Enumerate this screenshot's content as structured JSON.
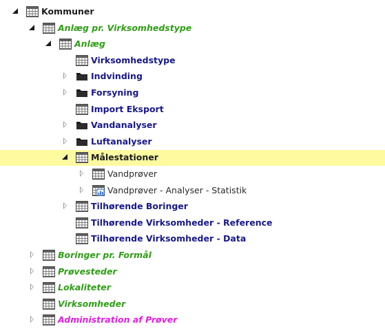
{
  "tree": {
    "nodes": [
      {
        "label": "Kommuner",
        "level": 0,
        "toggle": "expanded",
        "icon": "table-icon",
        "style": "bold-dark"
      },
      {
        "label": "Anlæg pr. Virksomhedstype",
        "level": 1,
        "toggle": "expanded",
        "icon": "table-icon",
        "style": "green"
      },
      {
        "label": "Anlæg",
        "level": 2,
        "toggle": "expanded",
        "icon": "table-icon",
        "style": "green"
      },
      {
        "label": "Virksomhedstype",
        "level": 3,
        "toggle": "none",
        "icon": "table-icon",
        "style": "navy"
      },
      {
        "label": "Indvinding",
        "level": 3,
        "toggle": "collapsed",
        "icon": "folder-icon",
        "style": "navy"
      },
      {
        "label": "Forsyning",
        "level": 3,
        "toggle": "collapsed",
        "icon": "folder-icon",
        "style": "navy"
      },
      {
        "label": "Import Eksport",
        "level": 3,
        "toggle": "none",
        "icon": "table-icon",
        "style": "navy"
      },
      {
        "label": "Vandanalyser",
        "level": 3,
        "toggle": "collapsed",
        "icon": "folder-icon",
        "style": "navy"
      },
      {
        "label": "Luftanalyser",
        "level": 3,
        "toggle": "collapsed",
        "icon": "folder-icon",
        "style": "navy"
      },
      {
        "label": "Målestationer",
        "level": 3,
        "toggle": "expanded",
        "icon": "table-icon",
        "style": "bold-dark",
        "selected": true
      },
      {
        "label": "Vandprøver",
        "level": 4,
        "toggle": "collapsed",
        "icon": "table-icon",
        "style": "plain"
      },
      {
        "label": "Vandprøver - Analyser - Statistik",
        "level": 4,
        "toggle": "collapsed",
        "icon": "statistics-table-icon",
        "style": "plain"
      },
      {
        "label": "Tilhørende Boringer",
        "level": 3,
        "toggle": "collapsed",
        "icon": "table-icon",
        "style": "navy"
      },
      {
        "label": "Tilhørende Virksomheder - Reference",
        "level": 3,
        "toggle": "none",
        "icon": "table-icon",
        "style": "navy"
      },
      {
        "label": "Tilhørende Virksomheder - Data",
        "level": 3,
        "toggle": "none",
        "icon": "table-icon",
        "style": "navy"
      },
      {
        "label": "Boringer pr. Formål",
        "level": 1,
        "toggle": "collapsed",
        "icon": "table-icon",
        "style": "green"
      },
      {
        "label": "Prøvesteder",
        "level": 1,
        "toggle": "collapsed",
        "icon": "table-icon",
        "style": "green"
      },
      {
        "label": "Lokaliteter",
        "level": 1,
        "toggle": "collapsed",
        "icon": "table-icon",
        "style": "green"
      },
      {
        "label": "Virksomheder",
        "level": 1,
        "toggle": "none",
        "icon": "table-icon",
        "style": "green"
      },
      {
        "label": "Administration af Prøver",
        "level": 1,
        "toggle": "collapsed",
        "icon": "table-icon",
        "style": "magenta"
      }
    ]
  },
  "colors": {
    "selected_row": "#fdfaa0",
    "green_label": "#2f9e16",
    "navy_label": "#18188c",
    "magenta_label": "#e21ee2",
    "dark_label": "#1c1c1c"
  }
}
